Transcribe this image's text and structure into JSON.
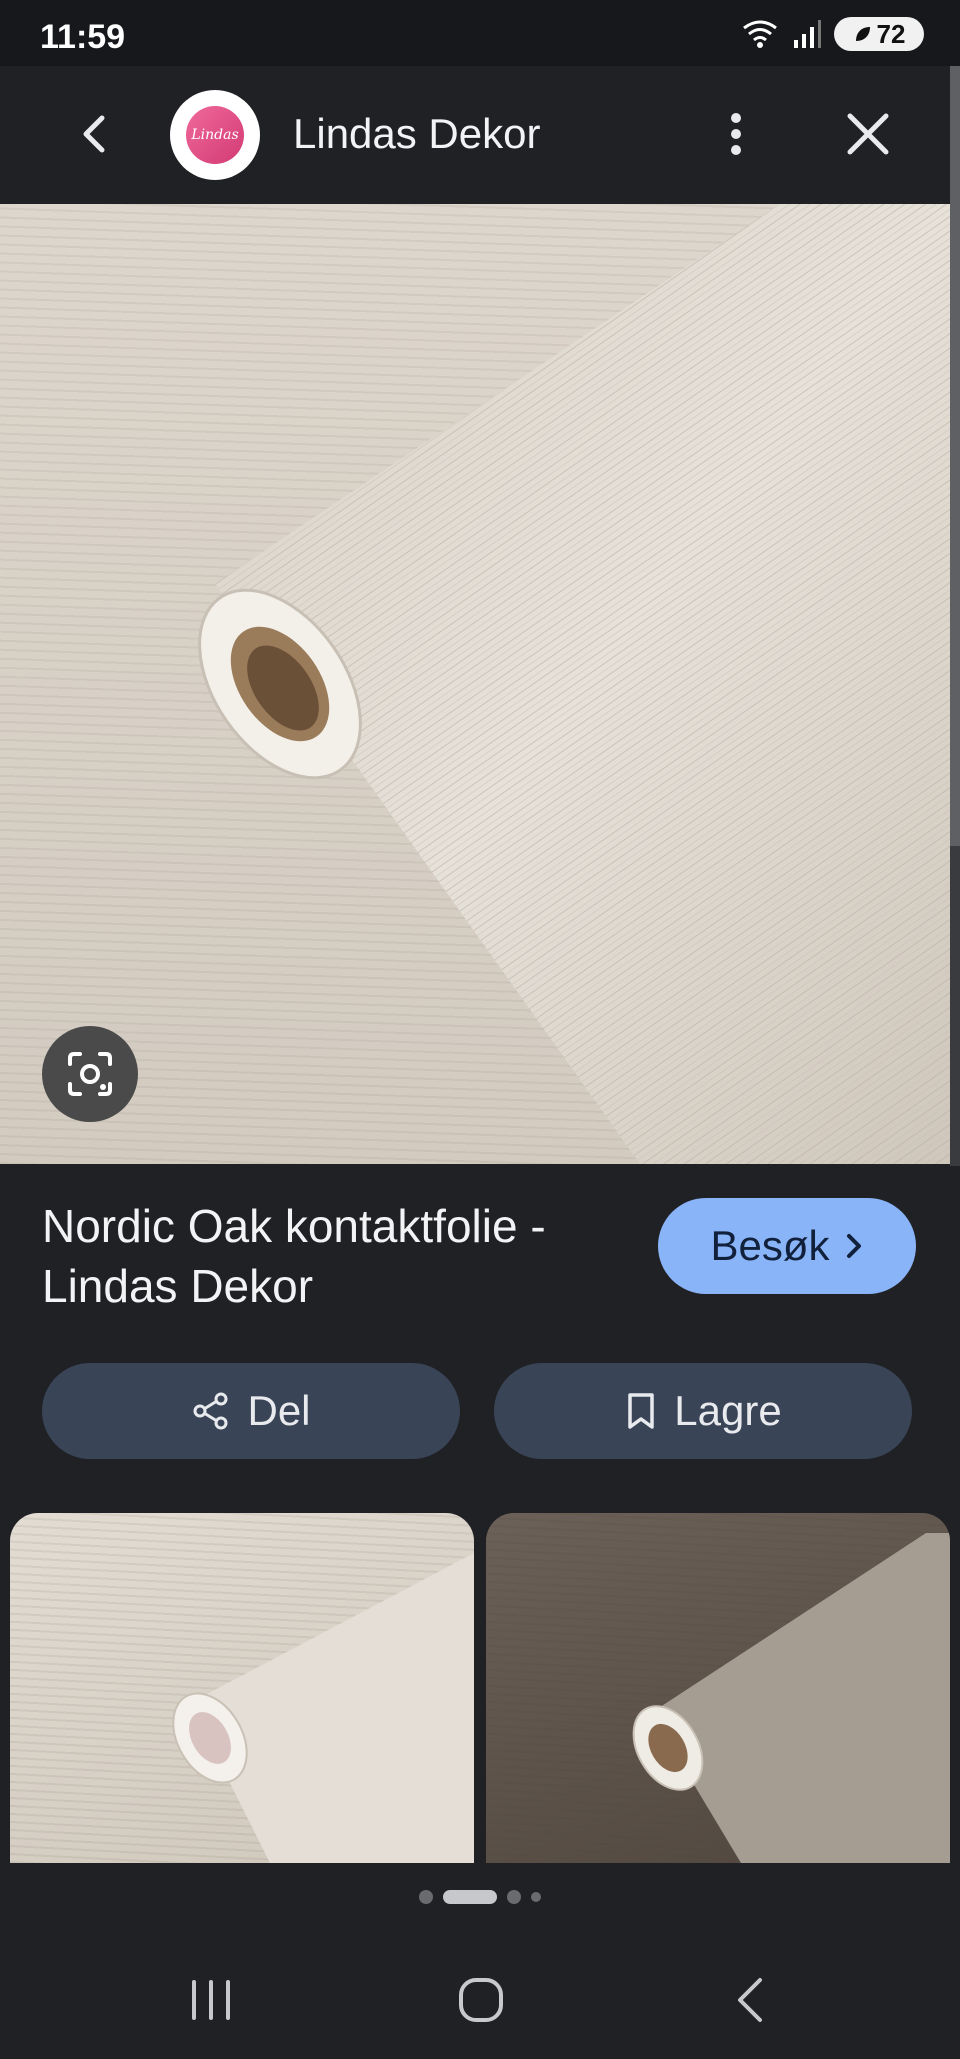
{
  "status_bar": {
    "time": "11:59",
    "battery": "72"
  },
  "header": {
    "site_name": "Lindas Dekor",
    "avatar_text": "Lindas"
  },
  "result": {
    "title": "Nordic Oak kontaktfolie - Lindas Dekor",
    "visit_label": "Besøk",
    "share_label": "Del",
    "save_label": "Lagre"
  },
  "colors": {
    "background": "#202124",
    "visit_button": "#8ab4f8",
    "action_button": "#394457"
  },
  "icons": {
    "back": "chevron-left-icon",
    "more": "more-vert-icon",
    "close": "close-icon",
    "lens": "lens-icon",
    "share": "share-icon",
    "save": "bookmark-icon",
    "visit": "chevron-right-icon"
  },
  "pager": {
    "count": 4,
    "active_index": 1
  }
}
